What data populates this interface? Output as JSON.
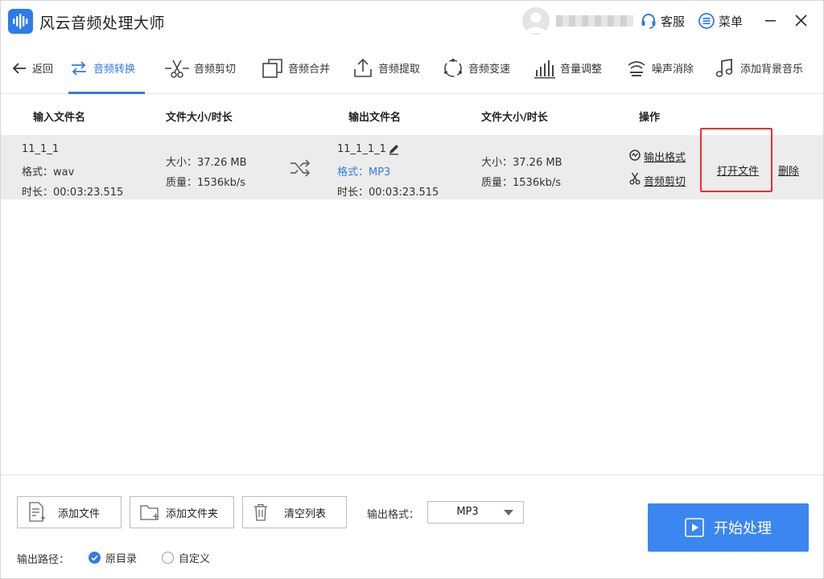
{
  "app": {
    "title": "风云音频处理大师"
  },
  "header": {
    "service_label": "客服",
    "menu_label": "菜单"
  },
  "toolbar": {
    "back_label": "返回",
    "tools": [
      {
        "label": "音频转换"
      },
      {
        "label": "音频剪切"
      },
      {
        "label": "音频合并"
      },
      {
        "label": "音频提取"
      },
      {
        "label": "音频变速"
      },
      {
        "label": "音量调整"
      },
      {
        "label": "噪声消除"
      },
      {
        "label": "添加背景音乐"
      }
    ],
    "active_tool": "音频转换"
  },
  "table": {
    "headers": [
      "输入文件名",
      "文件大小/时长",
      "输出文件名",
      "文件大小/时长",
      "操作"
    ],
    "rows": [
      {
        "input_name": "11_1_1",
        "input_format": "格式：wav",
        "input_duration": "时长：00:03:23.515",
        "input_size": "大小：37.26 MB",
        "input_quality": "质量：1536kb/s",
        "output_name": "11_1_1_1",
        "output_format": "格式：MP3",
        "output_duration": "时长：00:03:23.515",
        "output_size": "大小：37.26 MB",
        "output_quality": "质量：1536kb/s",
        "op_output_format": "输出格式",
        "op_audio_cut": "音频剪切",
        "op_open_file": "打开文件",
        "op_delete": "删除"
      }
    ]
  },
  "bottom": {
    "add_file": "添加文件",
    "add_folder": "添加文件夹",
    "clear_list": "清空列表",
    "format_label": "输出格式：",
    "format_value": "MP3",
    "start_label": "开始处理",
    "path_label": "输出路径：",
    "path_options": [
      {
        "label": "原目录",
        "selected": true
      },
      {
        "label": "自定义",
        "selected": false
      }
    ]
  },
  "colors": {
    "accent": "#2f7bec",
    "highlight": "#e8302c",
    "row_bg": "#ececec"
  }
}
